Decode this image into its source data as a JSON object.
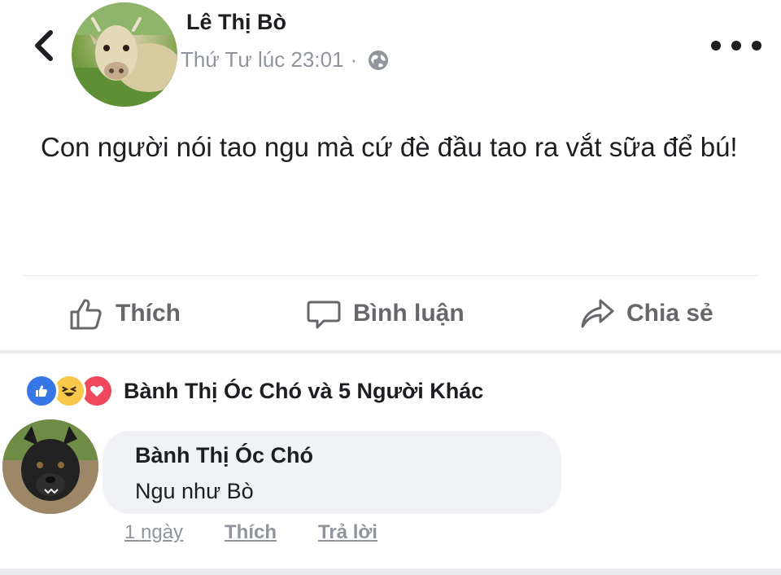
{
  "post": {
    "author": "Lê Thị Bò",
    "timestamp": "Thứ Tư lúc 23:01",
    "separator": "·",
    "privacy_icon": "globe-icon",
    "text": "Con người nói tao ngu mà cứ đè đầu tao ra vắt sữa để bú!"
  },
  "actions": {
    "like": "Thích",
    "comment": "Bình luận",
    "share": "Chia sẻ"
  },
  "reactions": {
    "icons": [
      "like-icon",
      "haha-icon",
      "love-icon"
    ],
    "summary": "Bành Thị Óc Chó và 5 Người Khác"
  },
  "comment": {
    "author": "Bành Thị Óc Chó",
    "text": "Ngu như Bò",
    "time": "1 ngày",
    "like": "Thích",
    "reply": "Trả lời"
  },
  "colors": {
    "like_blue": "#3578e5",
    "haha_yellow": "#f7c84b",
    "love_red": "#f0485c",
    "muted_text": "#90949c"
  }
}
